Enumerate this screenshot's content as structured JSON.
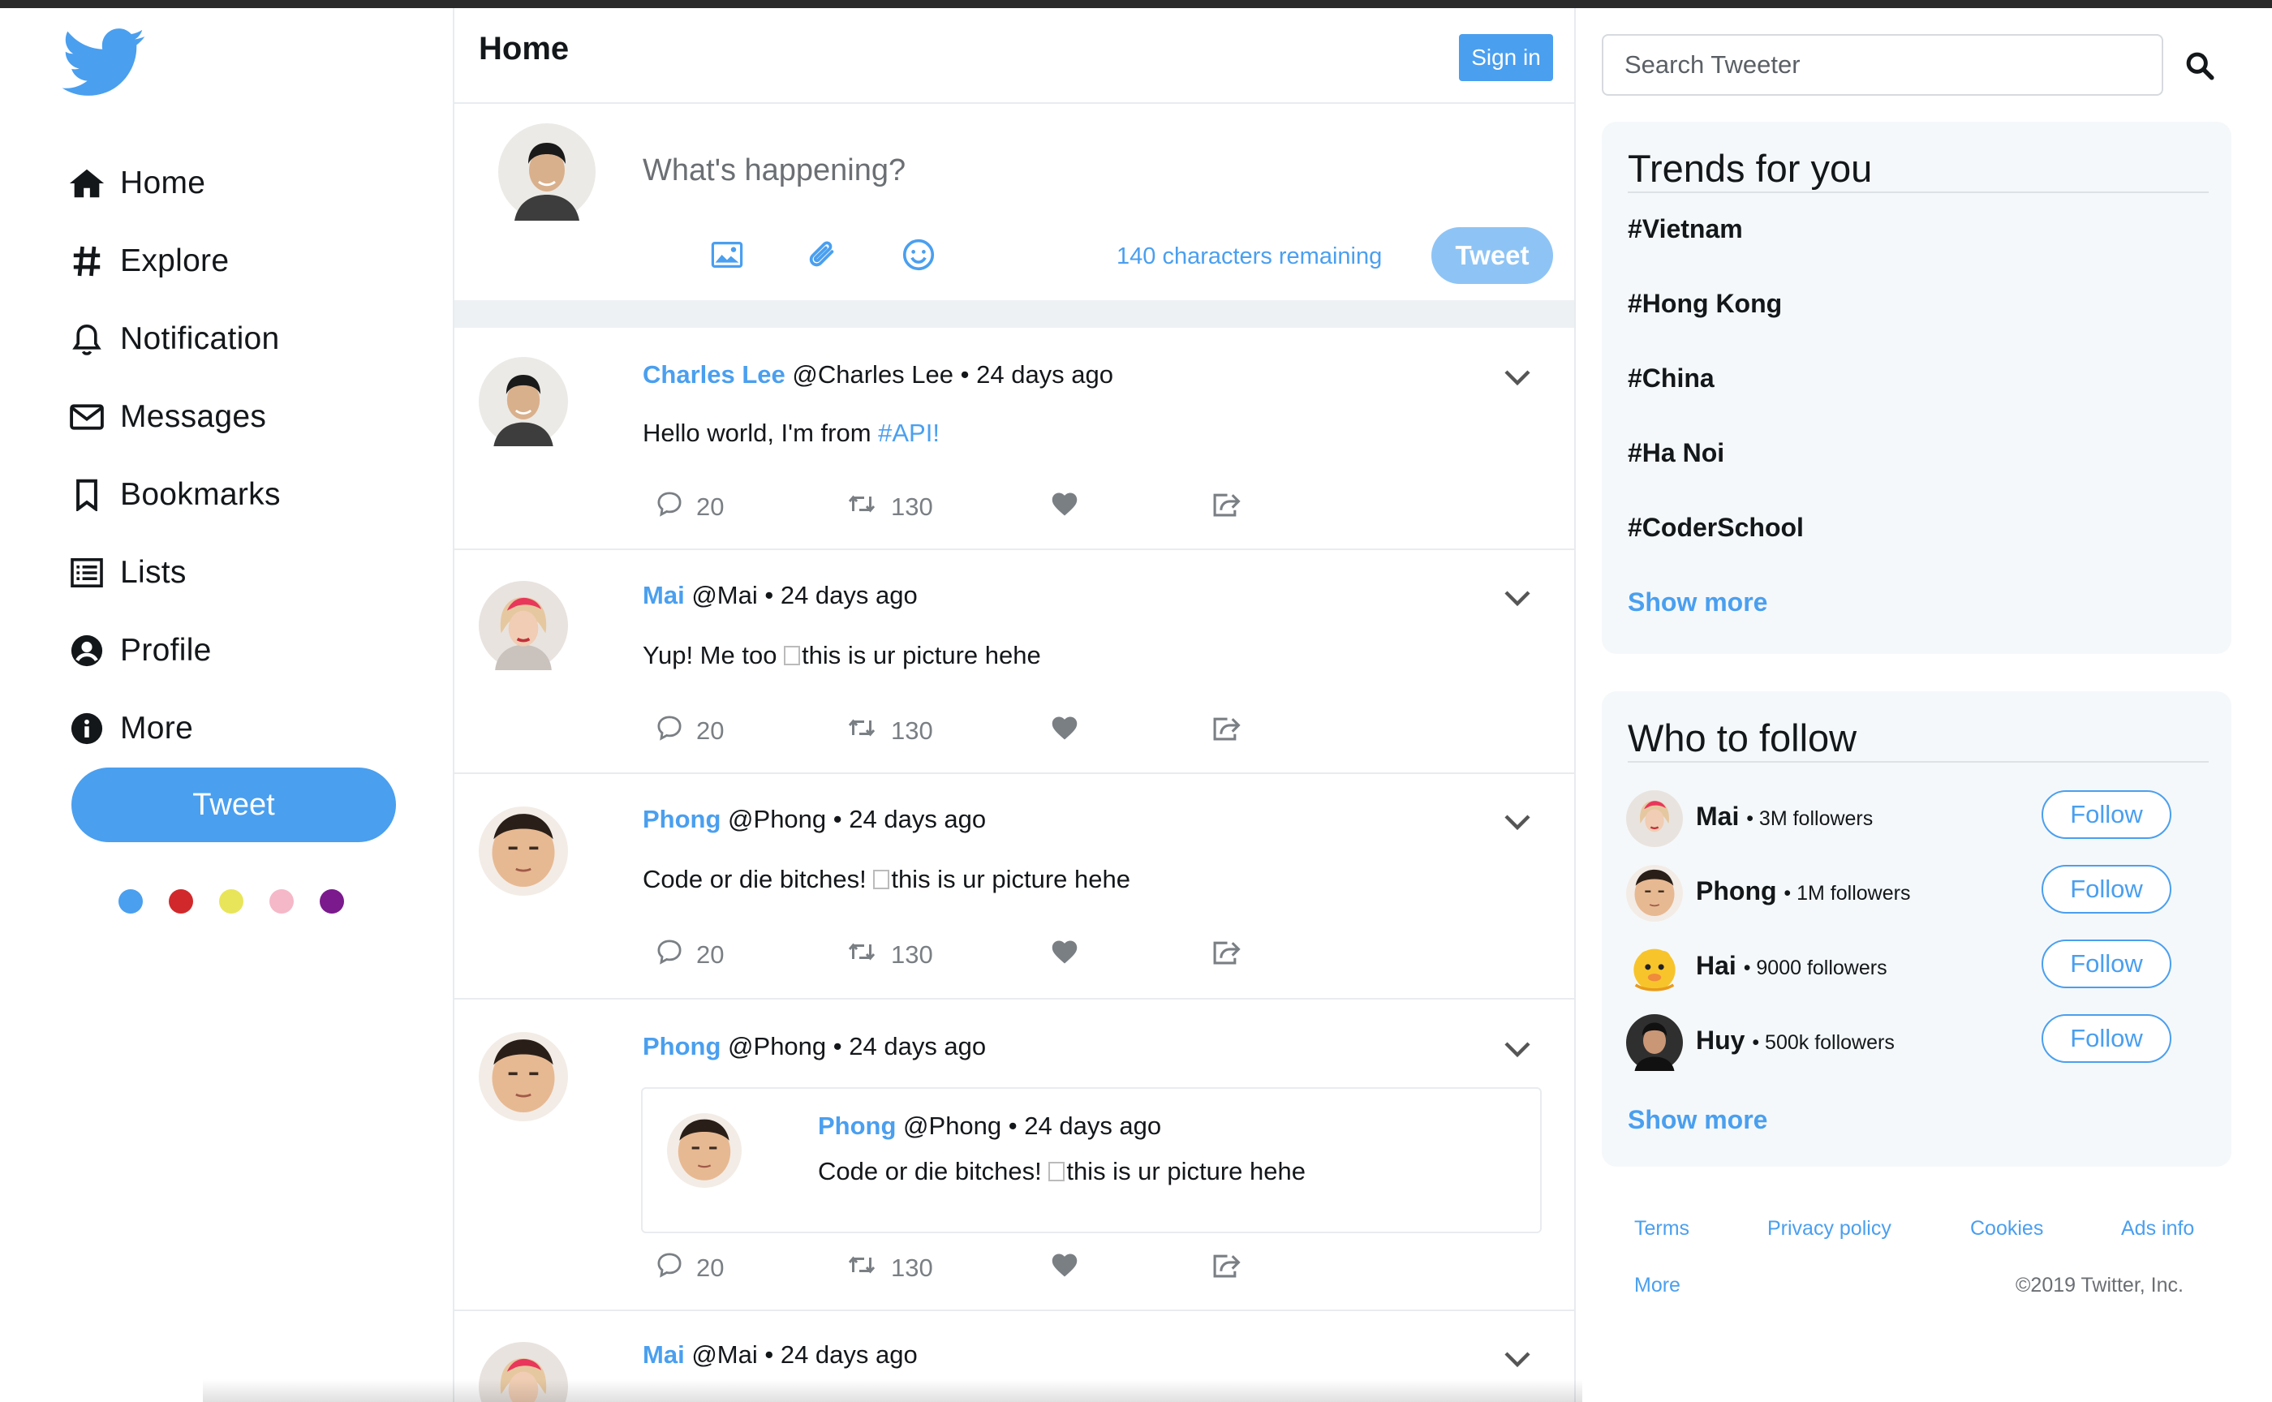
{
  "sidebar": {
    "logo_icon": "bird-icon",
    "nav": [
      {
        "label": "Home",
        "icon": "home-icon"
      },
      {
        "label": "Explore",
        "icon": "hashtag-icon"
      },
      {
        "label": "Notification",
        "icon": "bell-icon"
      },
      {
        "label": "Messages",
        "icon": "envelope-icon"
      },
      {
        "label": "Bookmarks",
        "icon": "bookmark-icon"
      },
      {
        "label": "Lists",
        "icon": "list-icon"
      },
      {
        "label": "Profile",
        "icon": "user-circle-icon"
      },
      {
        "label": "More",
        "icon": "info-circle-icon"
      }
    ],
    "tweet_button": "Tweet",
    "theme_colors": [
      "#4a9fef",
      "#d1292b",
      "#e8e55a",
      "#f5b8c8",
      "#7a1a8c"
    ]
  },
  "header": {
    "title": "Home",
    "signin_label": "Sign in"
  },
  "composer": {
    "placeholder": "What's happening?",
    "chars_remaining": "140 characters remaining",
    "tweet_label": "Tweet",
    "icons": [
      "image-icon",
      "paperclip-icon",
      "smile-icon"
    ]
  },
  "tweets": [
    {
      "name": "Charles Lee",
      "handle": "@Charles Lee",
      "time": "• 24 days ago",
      "text": "Hello world, I'm from ",
      "tag": "#API!",
      "comments": "20",
      "retweets": "130"
    },
    {
      "name": "Mai",
      "handle": "@Mai",
      "time": "• 24 days ago",
      "text": "Yup! Me too ",
      "image_alt": "this is ur picture hehe",
      "comments": "20",
      "retweets": "130"
    },
    {
      "name": "Phong",
      "handle": "@Phong",
      "time": "• 24 days ago",
      "text": "Code or die bitches! ",
      "image_alt": "this is ur picture hehe",
      "comments": "20",
      "retweets": "130"
    },
    {
      "name": "Phong",
      "handle": "@Phong",
      "time": "• 24 days ago",
      "quote": {
        "name": "Phong",
        "handle": "@Phong",
        "time": "• 24 days ago",
        "text": "Code or die bitches! ",
        "image_alt": "this is ur picture hehe"
      },
      "comments": "20",
      "retweets": "130"
    },
    {
      "name": "Mai",
      "handle": "@Mai",
      "time": "• 24 days ago"
    }
  ],
  "search": {
    "placeholder": "Search Tweeter"
  },
  "trends": {
    "title": "Trends for you",
    "items": [
      "#Vietnam",
      "#Hong Kong",
      "#China",
      "#Ha Noi",
      "#CoderSchool"
    ],
    "show_more": "Show more"
  },
  "who_to_follow": {
    "title": "Who to follow",
    "users": [
      {
        "name": "Mai",
        "followers": "• 3M followers"
      },
      {
        "name": "Phong",
        "followers": "• 1M followers"
      },
      {
        "name": "Hai",
        "followers": "• 9000 followers"
      },
      {
        "name": "Huy",
        "followers": "• 500k followers"
      }
    ],
    "follow_label": "Follow",
    "show_more": "Show more"
  },
  "footer": {
    "links": [
      "Terms",
      "Privacy policy",
      "Cookies",
      "Ads info",
      "More"
    ],
    "copyright": "©2019 Twitter, Inc."
  },
  "colors": {
    "accent": "#4a9fef",
    "accent_light": "#8ec4f5",
    "panel_bg": "#f5f8fa"
  }
}
